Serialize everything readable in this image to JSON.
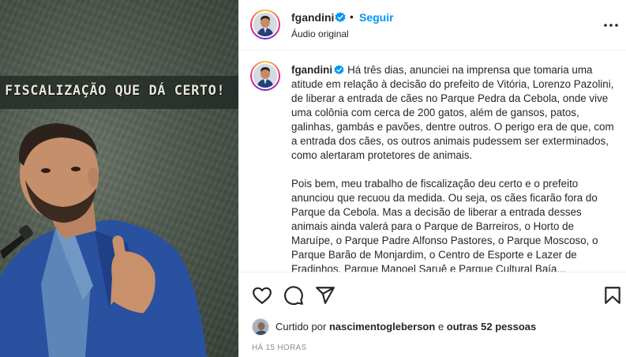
{
  "media": {
    "banner_text": "FISCALIZAÇÃO QUE DÁ CERTO!"
  },
  "header": {
    "username": "fgandini",
    "separator": "•",
    "follow_label": "Seguir",
    "audio_label": "Áudio original"
  },
  "caption": {
    "username": "fgandini",
    "paragraph1": "Há três dias, anunciei na imprensa que tomaria uma atitude em relação à decisão do prefeito de Vitória, Lorenzo Pazolini, de liberar a entrada de cães no Parque Pedra da Cebola, onde vive uma colônia com cerca de 200 gatos, além de gansos, patos, galinhas, gambás e pavões, dentre outros. O perigo era de que, com a entrada dos cães, os outros animais pudessem ser exterminados, como alertaram protetores de animais.",
    "paragraph2": "Pois bem, meu trabalho de fiscalização deu certo e o prefeito anunciou que recuou da medida. Ou seja, os cães ficarão fora do Parque da Cebola. Mas a decisão de liberar a entrada desses animais ainda valerá para o Parque de Barreiros, o Horto de Maruípe, o Parque Padre Alfonso Pastores, o Parque Moscoso, o Parque Barão de Monjardim, o Centro de Esporte e Lazer de Fradinhos, Parque Manoel Saruê e Parque Cultural Baía..."
  },
  "likes": {
    "prefix": "Curtido por",
    "user": "nascimentogleberson",
    "middle": "e",
    "others": "outras 52 pessoas"
  },
  "time_ago": "HÁ 15 HORAS",
  "icons": [
    "heart-icon",
    "comment-icon",
    "share-icon",
    "save-icon",
    "more-options-icon",
    "verified-icon"
  ],
  "colors": {
    "accent": "#0095f6",
    "text": "#262626",
    "muted": "#8e8e8e",
    "verified": "#0095f6",
    "banner_text": "#e8e8d8"
  }
}
